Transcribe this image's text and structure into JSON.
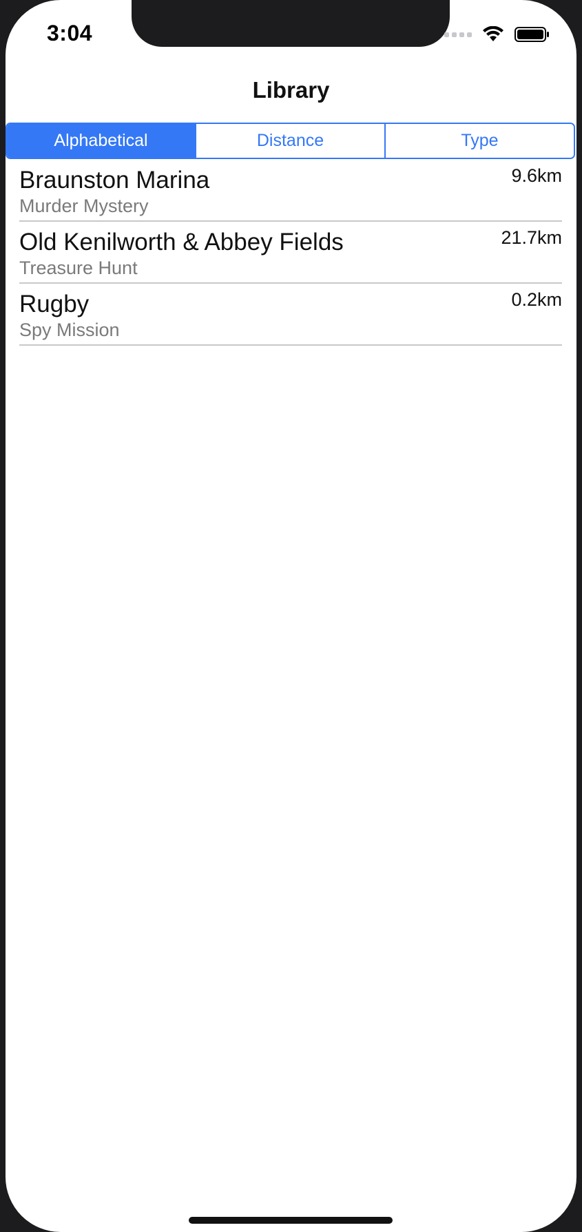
{
  "status_bar": {
    "time": "3:04",
    "icons": [
      "signal-icon",
      "wifi-icon",
      "battery-icon"
    ]
  },
  "nav": {
    "title": "Library"
  },
  "segments": {
    "items": [
      "Alphabetical",
      "Distance",
      "Type"
    ],
    "selected": "Alphabetical",
    "accent_color": "#3478f6"
  },
  "list": {
    "items": [
      {
        "title": "Braunston Marina",
        "subtitle": "Murder Mystery",
        "distance": "9.6km"
      },
      {
        "title": "Old Kenilworth & Abbey Fields",
        "subtitle": "Treasure Hunt",
        "distance": "21.7km"
      },
      {
        "title": "Rugby",
        "subtitle": "Spy Mission",
        "distance": "0.2km"
      }
    ]
  }
}
